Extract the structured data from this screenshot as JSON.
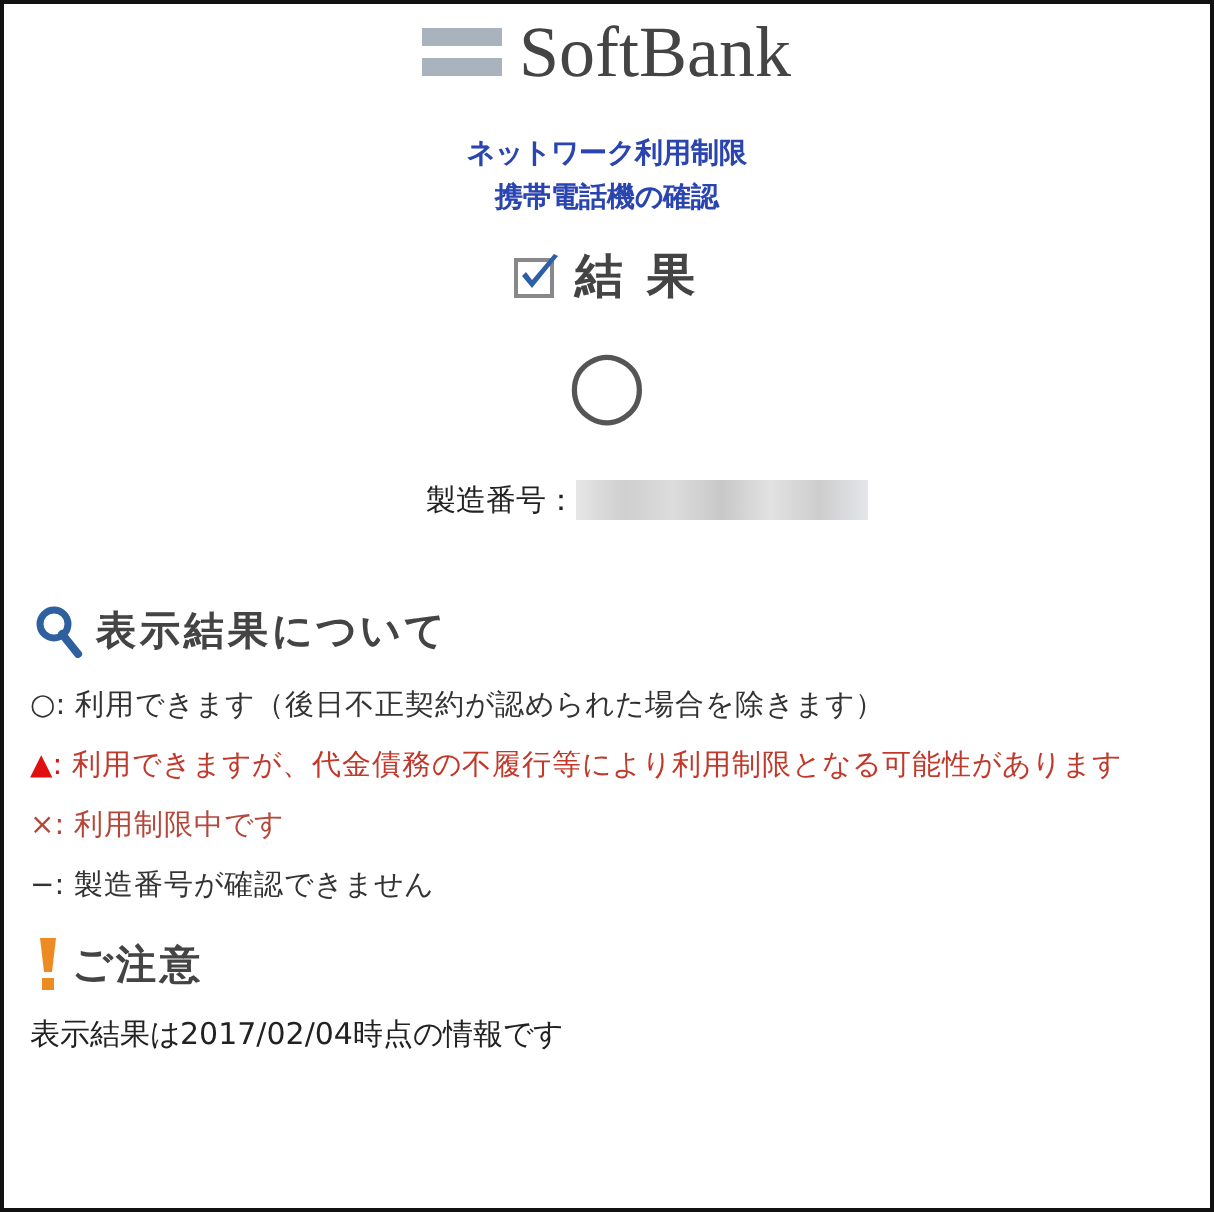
{
  "logo": {
    "text": "SoftBank"
  },
  "title_lines": [
    "ネットワーク利用制限",
    "携帯電話機の確認"
  ],
  "result": {
    "heading": "結 果",
    "symbol": "○",
    "serial_label": "製造番号："
  },
  "legend_section": {
    "heading": "表示結果について",
    "items": [
      {
        "symbol": "○:",
        "text": "利用できます（後日不正契約が認められた場合を除きます）",
        "color": "#333333"
      },
      {
        "symbol": "▲:",
        "text": "利用できますが、代金債務の不履行等により利用制限となる可能性があります",
        "color": "#c0392b"
      },
      {
        "symbol": "×:",
        "text": "利用制限中です",
        "color": "#b5473a"
      },
      {
        "symbol": "−:",
        "text": "製造番号が確認できません",
        "color": "#333333"
      }
    ]
  },
  "notice_section": {
    "heading": "ご注意",
    "text": "表示結果は2017/02/04時点の情報です"
  }
}
